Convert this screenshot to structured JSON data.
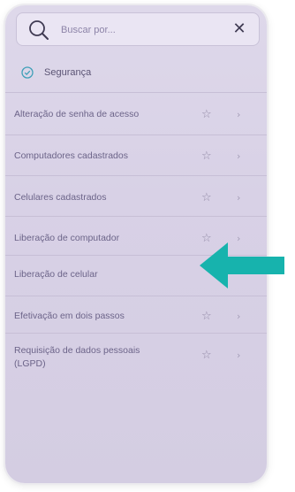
{
  "search": {
    "placeholder": "Buscar por...",
    "close_glyph": "✕"
  },
  "section": {
    "title": "Segurança",
    "icon": "shield-check-icon"
  },
  "items": [
    {
      "label": "Alteração de senha de acesso",
      "favorite_icon": "star-outline-icon",
      "nav_icon": "chevron-right-icon"
    },
    {
      "label": "Computadores cadastrados",
      "favorite_icon": "star-outline-icon",
      "nav_icon": "chevron-right-icon"
    },
    {
      "label": "Celulares cadastrados",
      "favorite_icon": "star-outline-icon",
      "nav_icon": "chevron-right-icon"
    },
    {
      "label": "Liberação de computador",
      "favorite_icon": "star-outline-icon",
      "nav_icon": "chevron-right-icon"
    },
    {
      "label": "Liberação de celular",
      "favorite_icon": "star-outline-icon",
      "nav_icon": "chevron-right-icon"
    },
    {
      "label": "Efetivação em dois passos",
      "favorite_icon": "star-outline-icon",
      "nav_icon": "chevron-right-icon"
    },
    {
      "label": "Requisição de dados pessoais (LGPD)",
      "favorite_icon": "star-outline-icon",
      "nav_icon": "chevron-right-icon"
    }
  ],
  "glyphs": {
    "star": "☆",
    "chevron": "›"
  },
  "colors": {
    "background": "#d8d1e6",
    "text": "#6c6489",
    "pointer_arrow": "#17b3ad"
  },
  "annotation": {
    "type": "pointer-arrow",
    "points_to_item": "Liberação de celular"
  }
}
